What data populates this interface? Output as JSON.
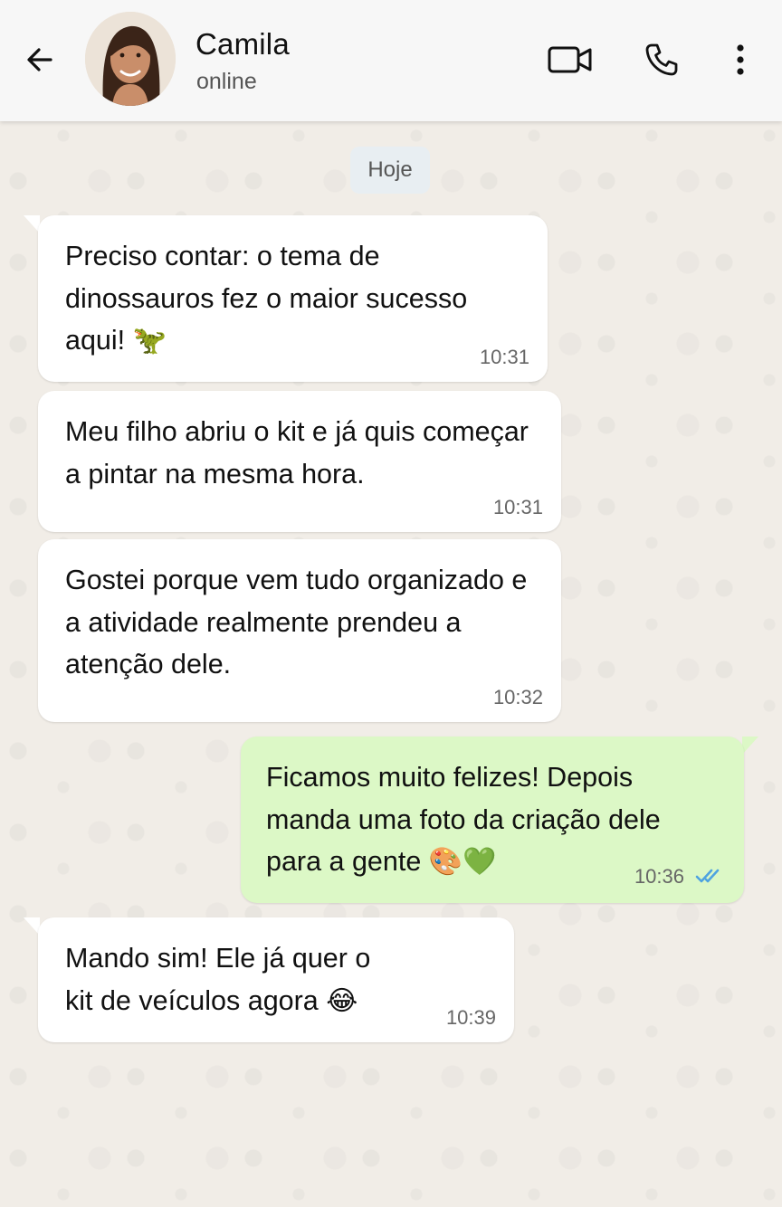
{
  "header": {
    "contact_name": "Camila",
    "status": "online"
  },
  "date_chip": "Hoje",
  "messages": [
    {
      "direction": "in",
      "text": "Preciso contar: o tema de dinossauros fez o maior sucesso aqui!",
      "emoji": "🦖",
      "time": "10:31"
    },
    {
      "direction": "in",
      "text": "Meu filho abriu o kit e já quis começar a pintar na mesma hora.",
      "time": "10:31"
    },
    {
      "direction": "in",
      "text": "Gostei porque vem tudo organizado e a atividade realmente prendeu a atenção dele.",
      "time": "10:32"
    },
    {
      "direction": "out",
      "text": "Ficamos muito felizes! Depois manda uma foto da criação dele para a gente",
      "emoji": "🎨💚",
      "time": "10:36",
      "status": "read"
    },
    {
      "direction": "in",
      "text": "Mando sim! Ele já quer o kit de veículos agora",
      "emoji": "😂",
      "time": "10:39"
    }
  ],
  "colors": {
    "incoming_bubble": "#ffffff",
    "outgoing_bubble": "#dcf8c6",
    "read_ticks": "#4fa3e0",
    "header_bg": "#f7f7f7"
  },
  "icons": [
    "back-arrow-icon",
    "video-camera-icon",
    "phone-icon",
    "more-vertical-icon",
    "double-check-icon"
  ]
}
